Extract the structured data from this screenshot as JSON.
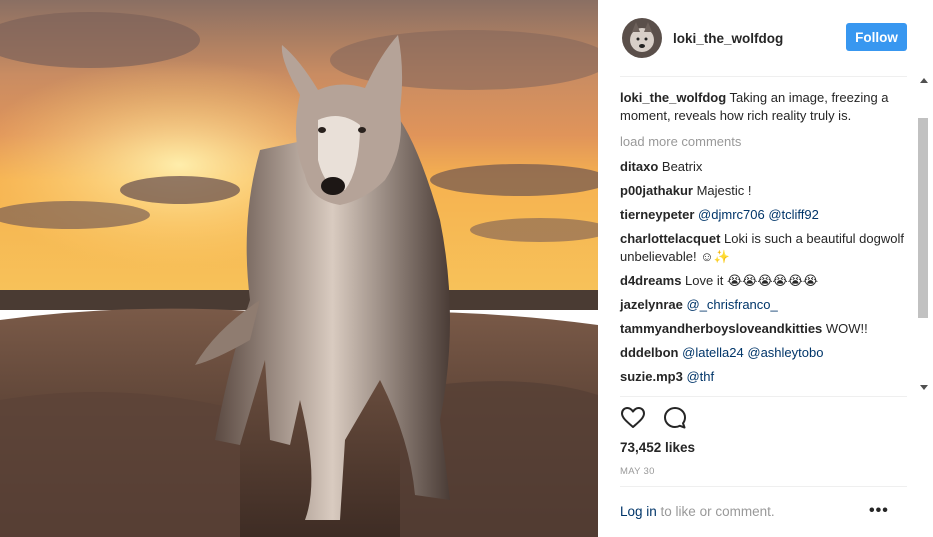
{
  "post": {
    "author": "loki_the_wolfdog",
    "follow_label": "Follow",
    "photo_subject": "wolfdog-on-rocks-at-sunset"
  },
  "caption": {
    "username": "loki_the_wolfdog",
    "text": " Taking an image, freezing a moment, reveals how rich reality truly is."
  },
  "load_more_label": "load more comments",
  "comments": [
    {
      "user": "ditaxo",
      "text": " Beatrix",
      "mentions": []
    },
    {
      "user": "p00jathakur",
      "text": " Majestic !",
      "mentions": []
    },
    {
      "user": "tierneypeter",
      "text": " ",
      "mentions": [
        "@djmrc706",
        "@tcliff92"
      ]
    },
    {
      "user": "charlottelacquet",
      "text": " Loki is such a beautiful dogwolf unbelievable! ☺✨",
      "mentions": []
    },
    {
      "user": "d4dreams",
      "text": " Love it 😭😭😭😭😭😭",
      "mentions": []
    },
    {
      "user": "jazelynrae",
      "text": " ",
      "mentions": [
        "@_chrisfranco_"
      ]
    },
    {
      "user": "tammyandherboysloveandkitties",
      "text": " WOW!!",
      "mentions": []
    },
    {
      "user": "dddelbon",
      "text": " ",
      "mentions": [
        "@latella24",
        "@ashleytobo"
      ]
    },
    {
      "user": "suzie.mp3",
      "text": " ",
      "mentions": [
        "@thf"
      ]
    }
  ],
  "likes_label": "73,452 likes",
  "date_label": "MAY 30",
  "footer": {
    "login_link": "Log in",
    "login_text": " to like or comment.",
    "more_label": "•••"
  },
  "icons": {
    "like": "heart-icon",
    "comment": "comment-bubble-icon",
    "more": "more-options-icon"
  },
  "colors": {
    "accent": "#3897f0",
    "link": "#003569",
    "muted": "#999999",
    "text": "#262626"
  }
}
